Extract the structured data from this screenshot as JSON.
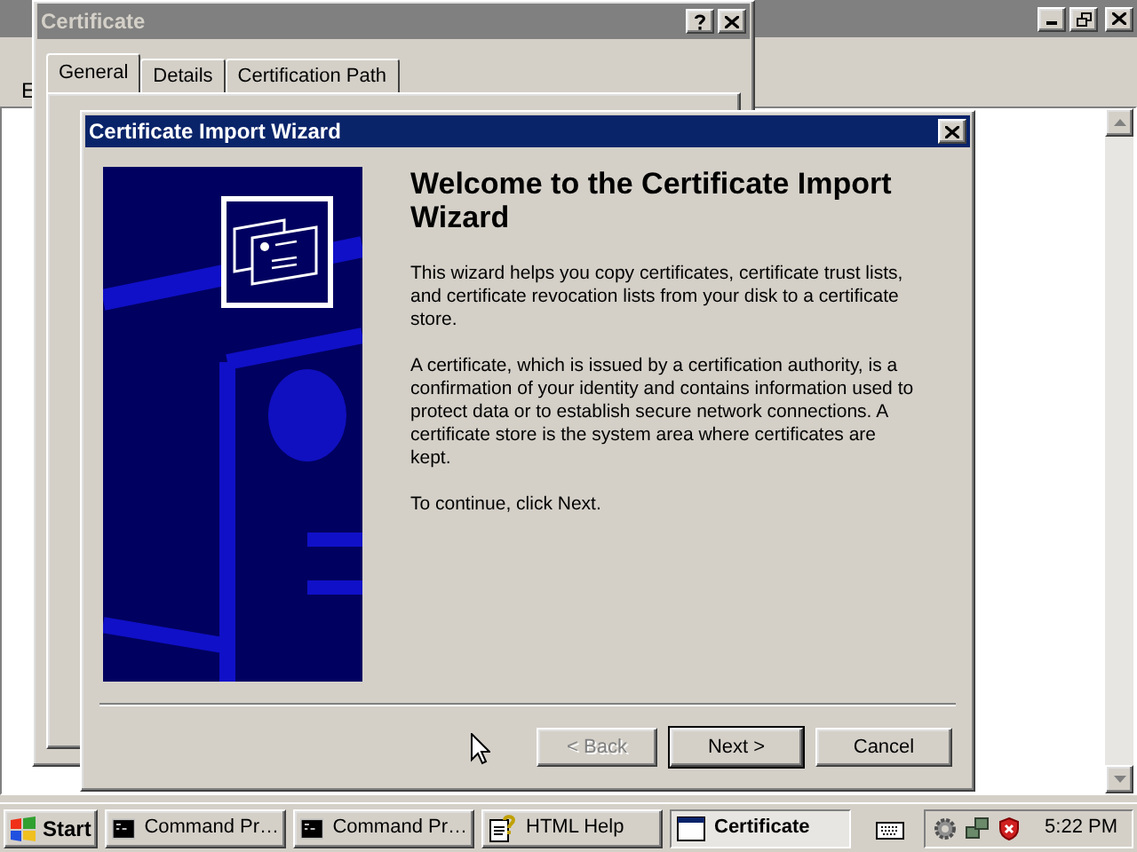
{
  "background_window": {
    "clipped_label": "E"
  },
  "certificate_dialog": {
    "title": "Certificate",
    "tabs": [
      {
        "label": "General",
        "selected": true
      },
      {
        "label": "Details",
        "selected": false
      },
      {
        "label": "Certification Path",
        "selected": false
      }
    ]
  },
  "wizard": {
    "title": "Certificate Import Wizard",
    "heading": "Welcome to the Certificate Import Wizard",
    "paragraphs": [
      "This wizard helps you copy certificates, certificate trust lists, and certificate revocation lists from your disk to a certificate store.",
      "A certificate, which is issued by a certification authority, is a confirmation of your identity and contains information used to protect data or to establish secure network connections. A certificate store is the system area where certificates are kept.",
      "To continue, click Next."
    ],
    "buttons": [
      {
        "label": "< Back",
        "disabled": true,
        "default": false
      },
      {
        "label": "Next >",
        "disabled": false,
        "default": true
      },
      {
        "label": "Cancel",
        "disabled": false,
        "default": false
      }
    ]
  },
  "taskbar": {
    "start": "Start",
    "tasks": [
      {
        "label": "Command Pr…",
        "kind": "console",
        "selected": false
      },
      {
        "label": "Command Pr…",
        "kind": "console",
        "selected": false
      },
      {
        "label": "HTML Help",
        "kind": "help",
        "selected": false
      },
      {
        "label": "Certificate",
        "kind": "window",
        "selected": true
      }
    ],
    "clock": "5:22 PM"
  }
}
